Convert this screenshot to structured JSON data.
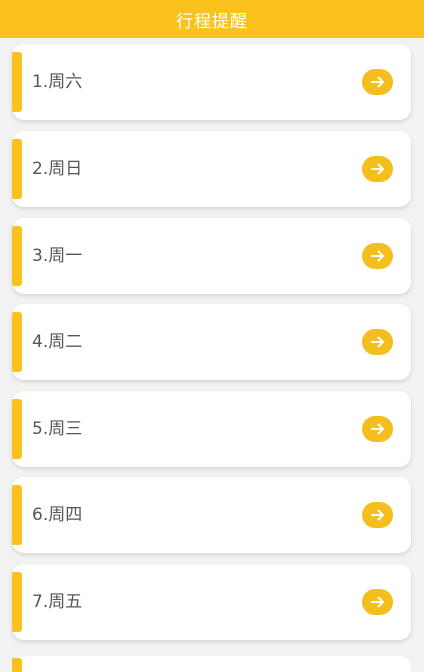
{
  "header": {
    "title": "行程提醒",
    "background": "#fbc21e"
  },
  "list": {
    "items": [
      {
        "label": "1.周六",
        "icon": "arrow-right-circle-icon"
      },
      {
        "label": "2.周日",
        "icon": "arrow-right-circle-icon"
      },
      {
        "label": "3.周一",
        "icon": "arrow-right-circle-icon"
      },
      {
        "label": "4.周二",
        "icon": "arrow-right-circle-icon"
      },
      {
        "label": "5.周三",
        "icon": "arrow-right-circle-icon"
      },
      {
        "label": "6.周四",
        "icon": "arrow-right-circle-icon"
      },
      {
        "label": "7.周五",
        "icon": "arrow-right-circle-icon"
      }
    ]
  },
  "colors": {
    "accent": "#fbc21e",
    "arrow_button": "#f4be1d",
    "card": "#ffffff",
    "page_background": "#f2f2f2",
    "label_text": "#555555"
  }
}
